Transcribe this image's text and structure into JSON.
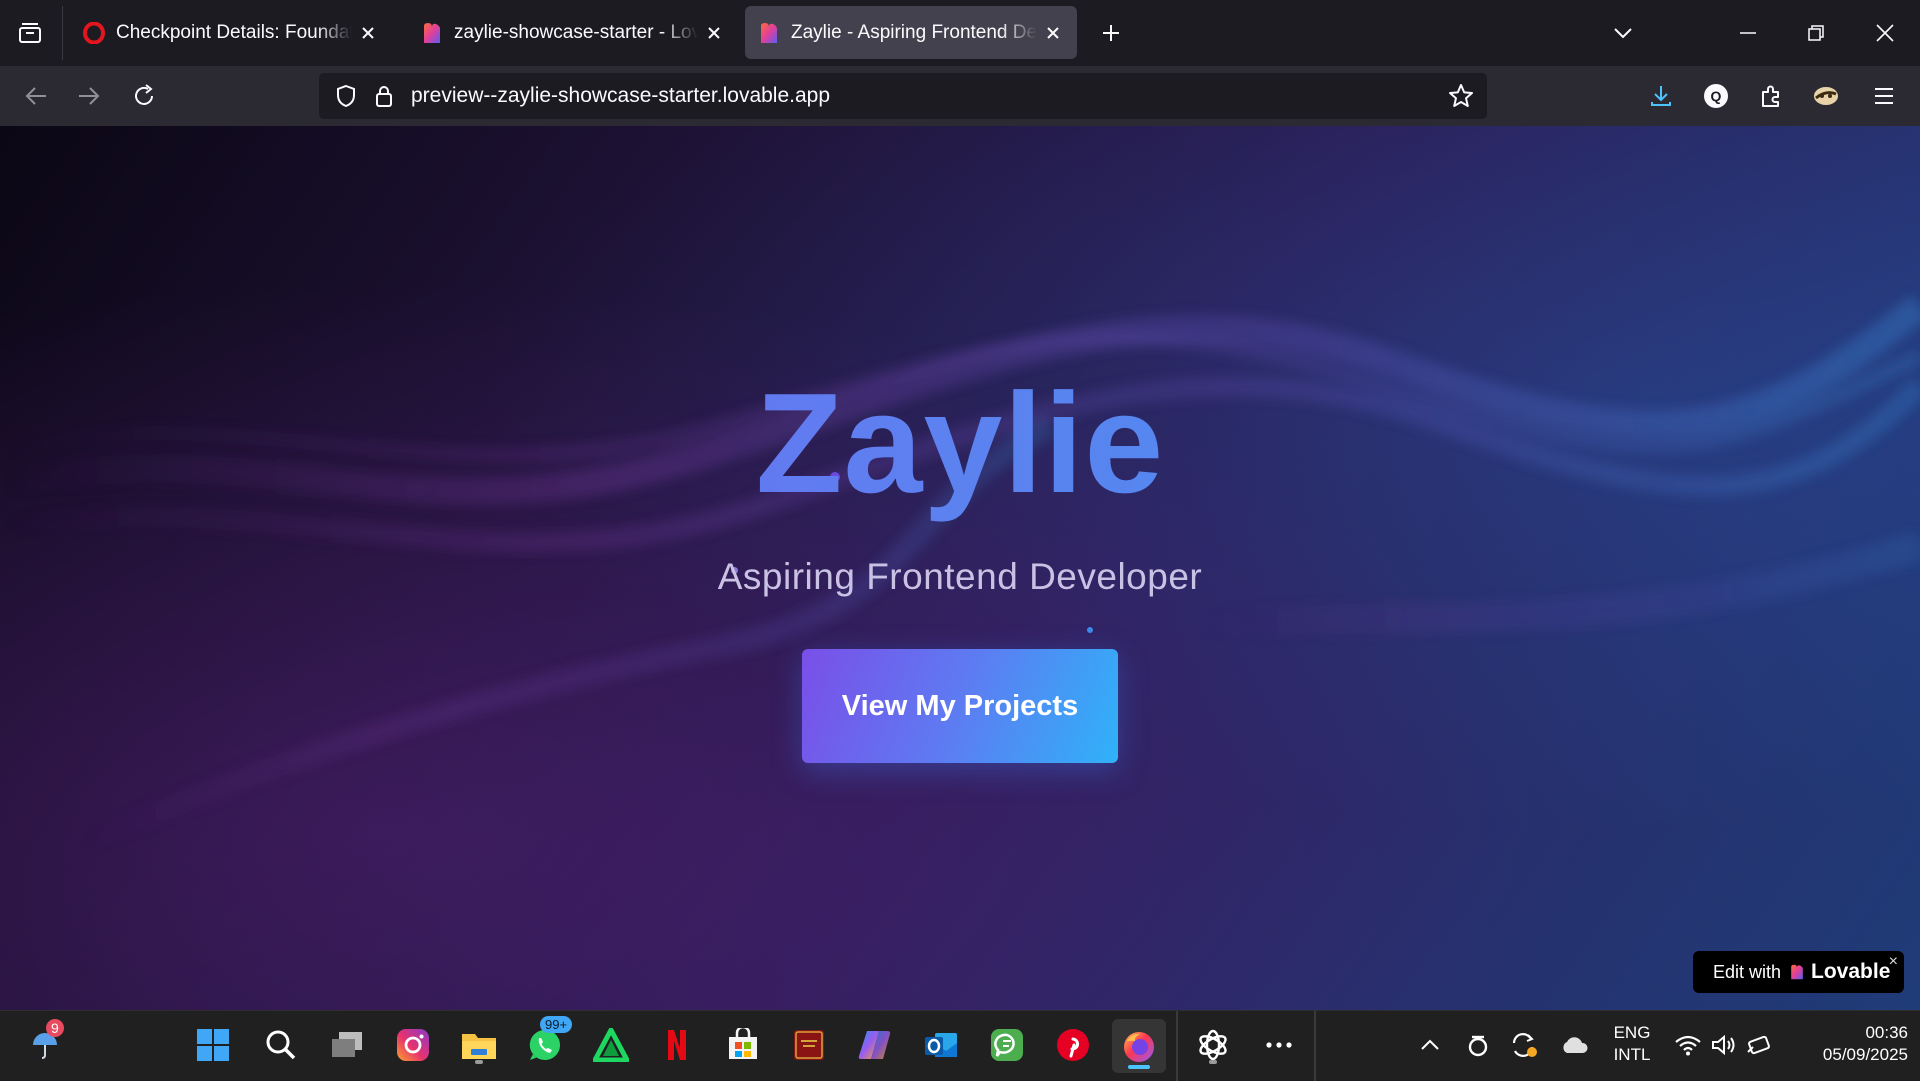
{
  "browser": {
    "tabs": [
      {
        "title": "Checkpoint Details: Foundations",
        "favicon": "opera-red-icon",
        "active": false
      },
      {
        "title": "zaylie-showcase-starter - Lovable",
        "favicon": "lovable-heart-icon",
        "active": false
      },
      {
        "title": "Zaylie - Aspiring Frontend Developer",
        "favicon": "lovable-heart-icon",
        "active": true
      }
    ],
    "url": "preview--zaylie-showcase-starter.lovable.app"
  },
  "hero": {
    "title": "Zaylie",
    "subtitle": "Aspiring Frontend Developer",
    "cta_label": "View My Projects"
  },
  "lovable_badge": {
    "prefix": "Edit with",
    "brand": "Lovable",
    "close": "×"
  },
  "taskbar": {
    "weather_badge": "9",
    "whatsapp_badge": "99+",
    "language_line1": "ENG",
    "language_line2": "INTL",
    "time": "00:36",
    "date": "05/09/2025",
    "icons": [
      "start-icon",
      "search-icon",
      "task-view-icon",
      "instagram-icon",
      "file-explorer-icon",
      "whatsapp-icon",
      "app-green-triangle-icon",
      "netflix-icon",
      "microsoft-store-icon",
      "holy-bible-icon",
      "copilot-icon",
      "outlook-icon",
      "chat-app-icon",
      "pinterest-icon",
      "firefox-icon",
      "chatgpt-icon",
      "more-icon"
    ]
  },
  "colors": {
    "accent_purple": "#7a5bf0",
    "accent_blue": "#3d95ee",
    "chrome_bg": "#1c1b22",
    "toolbar_bg": "#2b2a33"
  }
}
